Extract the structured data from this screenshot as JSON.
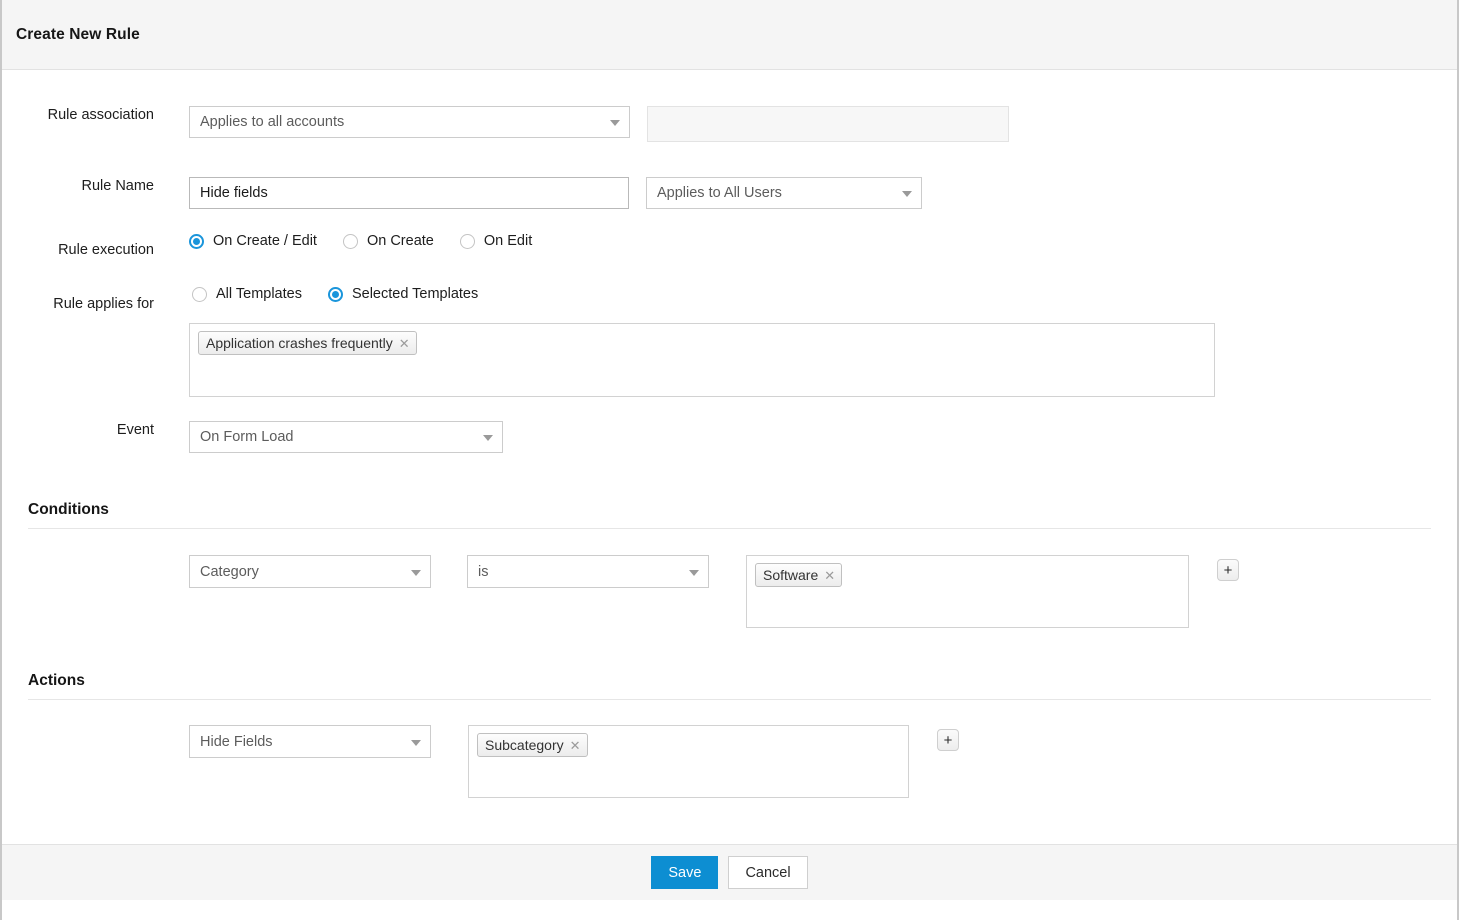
{
  "header": {
    "title": "Create New Rule"
  },
  "form": {
    "rule_association": {
      "label": "Rule association",
      "select_value": "Applies to all accounts",
      "account_field_value": "",
      "account_field_placeholder": ""
    },
    "rule_name": {
      "label": "Rule Name",
      "value": "Hide fields",
      "placeholder": "",
      "user_scope_value": "Applies to All Users"
    },
    "rule_execution": {
      "label": "Rule execution",
      "options": [
        {
          "label": "On Create / Edit",
          "selected": true
        },
        {
          "label": "On Create",
          "selected": false
        },
        {
          "label": "On Edit",
          "selected": false
        }
      ]
    },
    "rule_applies_for": {
      "label": "Rule applies for",
      "options": [
        {
          "label": "All Templates",
          "selected": false
        },
        {
          "label": "Selected Templates",
          "selected": true
        }
      ],
      "selected_templates": [
        {
          "label": "Application crashes frequently",
          "remove_icon": "close-icon"
        }
      ]
    },
    "event": {
      "label": "Event",
      "value": "On Form Load"
    }
  },
  "conditions": {
    "title": "Conditions",
    "rows": [
      {
        "field": "Category",
        "operator": "is",
        "values": [
          {
            "label": "Software",
            "remove_icon": "close-icon"
          }
        ],
        "add_label": "+"
      }
    ]
  },
  "actions": {
    "title": "Actions",
    "rows": [
      {
        "action": "Hide Fields",
        "values": [
          {
            "label": "Subcategory",
            "remove_icon": "close-icon"
          }
        ],
        "add_label": "+"
      }
    ]
  },
  "footer": {
    "save_label": "Save",
    "cancel_label": "Cancel"
  },
  "colors": {
    "accent_blue": "#0d8ed2",
    "radio_blue": "#1a95db",
    "header_bg": "#f5f5f5",
    "border": "#cccccc"
  }
}
